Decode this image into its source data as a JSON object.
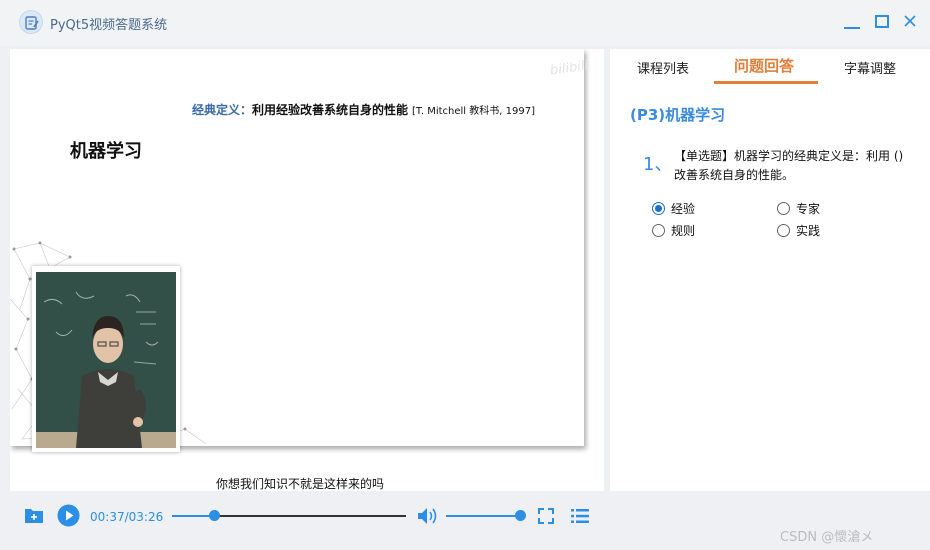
{
  "window": {
    "title": "PyQt5视频答题系统",
    "icon": "app-logo-icon",
    "controls": [
      "minimize-icon",
      "maximize-icon",
      "close-icon"
    ]
  },
  "video": {
    "slide_definition_label": "经典定义：",
    "slide_definition_text": "利用经验改善系统自身的性能",
    "slide_definition_ref": "[T. Mitchell 教科书, 1997]",
    "slide_title": "机器学习",
    "watermark": "bilibili",
    "subtitle": "你想我们知识不就是这样来的吗"
  },
  "panel": {
    "tabs": [
      {
        "label": "课程列表",
        "active": false
      },
      {
        "label": "问题回答",
        "active": true
      },
      {
        "label": "字幕调整",
        "active": false
      }
    ],
    "course_heading": "(P3)机器学习",
    "question": {
      "number": "1、",
      "text": "【单选题】机器学习的经典定义是：利用 () 改善系统自身的性能。",
      "options": [
        {
          "label": "经验",
          "selected": true
        },
        {
          "label": "专家",
          "selected": false
        },
        {
          "label": "规则",
          "selected": false
        },
        {
          "label": "实践",
          "selected": false
        }
      ]
    }
  },
  "player": {
    "time": "00:37/03:26",
    "progress_fraction": 0.18,
    "volume_fraction": 1.0,
    "icons": [
      "open-folder-icon",
      "play-icon",
      "volume-icon",
      "fullscreen-icon",
      "playlist-icon"
    ]
  },
  "colors": {
    "accent_blue": "#2b8fe6",
    "active_tab_orange": "#e0803a",
    "heading_blue": "#3a8be0"
  },
  "watermark_text": "CSDN @懷滄メ"
}
